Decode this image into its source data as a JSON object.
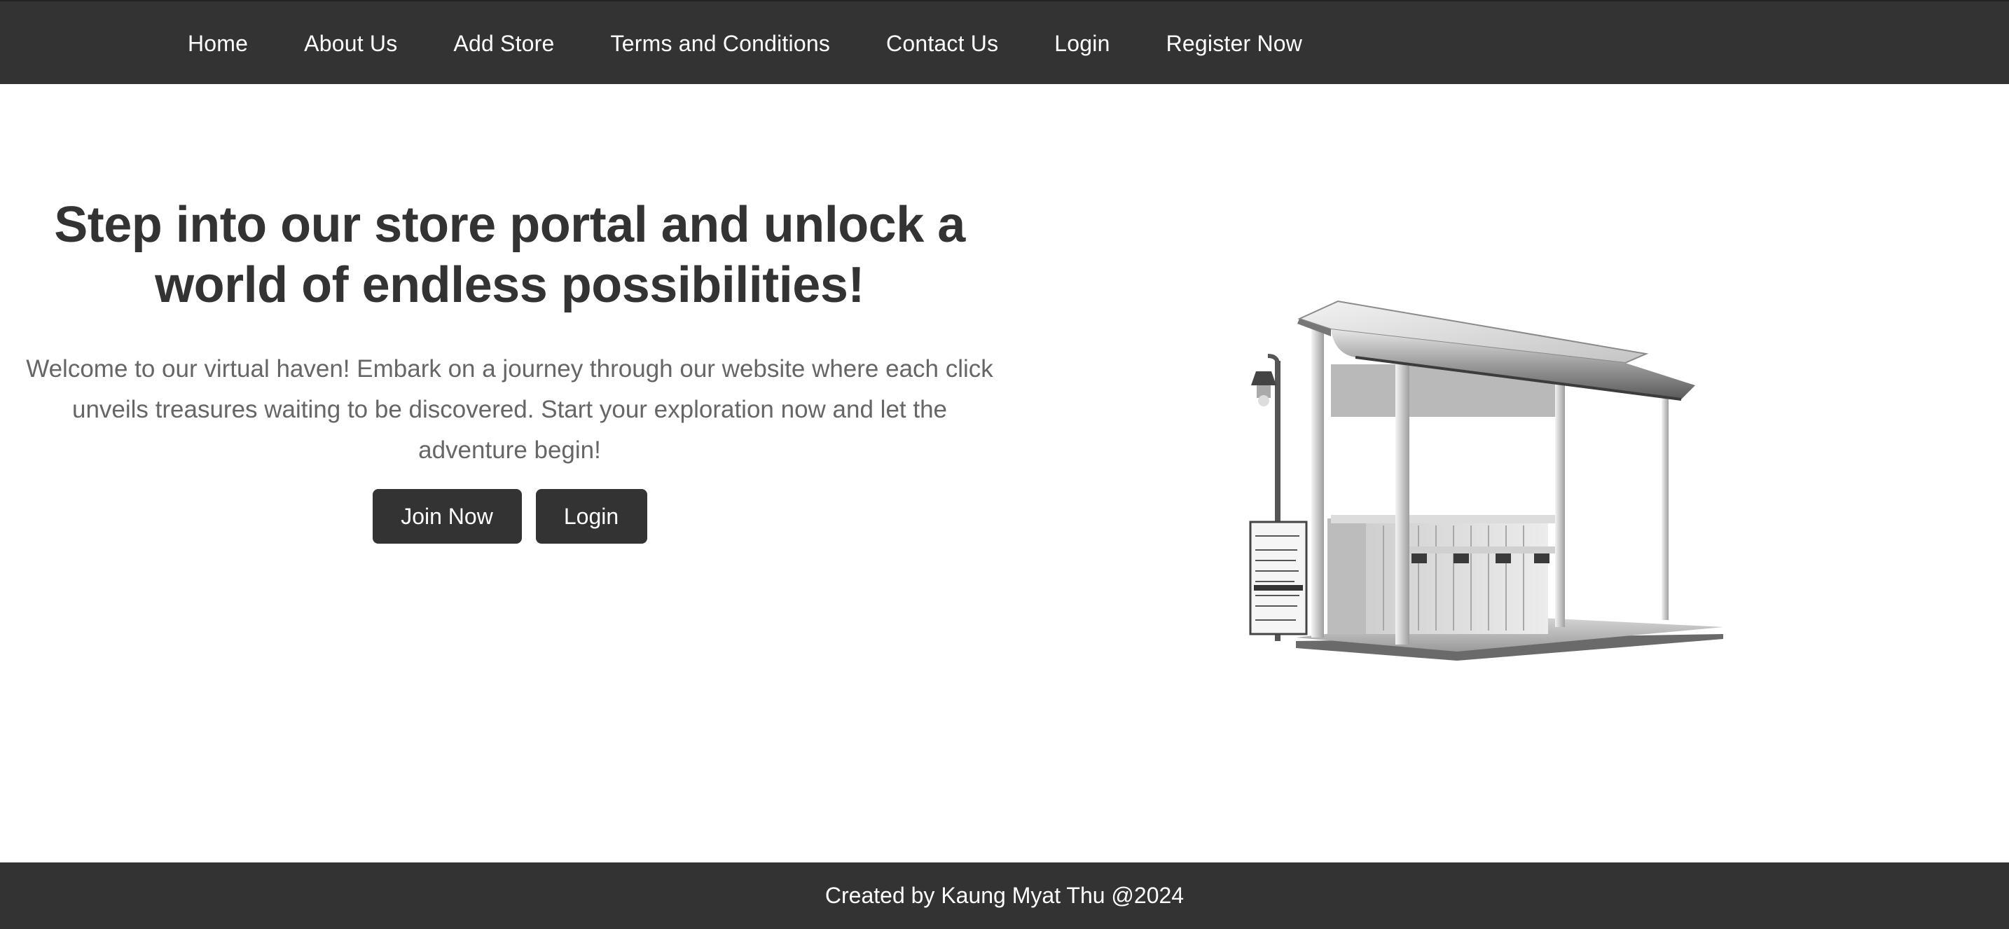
{
  "nav": {
    "items": [
      {
        "label": "Home"
      },
      {
        "label": "About Us"
      },
      {
        "label": "Add Store"
      },
      {
        "label": "Terms and Conditions"
      },
      {
        "label": "Contact Us"
      },
      {
        "label": "Login"
      },
      {
        "label": "Register Now"
      }
    ]
  },
  "hero": {
    "title": "Step into our store portal and unlock a world of endless possibilities!",
    "description": "Welcome to our virtual haven! Embark on a journey through our website where each click unveils treasures waiting to be discovered. Start your exploration now and let the adventure begin!",
    "join_label": "Join Now",
    "login_label": "Login",
    "image_icon": "market-stall-illustration"
  },
  "footer": {
    "text": "Created by Kaung Myat Thu @2024"
  },
  "colors": {
    "nav_bg": "#333333",
    "heading": "#333333",
    "body_text": "#666666",
    "button_bg": "#333333"
  }
}
